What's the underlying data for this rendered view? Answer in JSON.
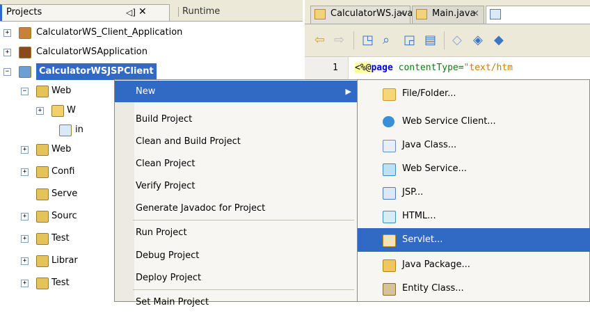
{
  "projects_panel": {
    "tab_projects": "Projects",
    "tab_runtime": "Runtime",
    "pin_glyph": "◁]",
    "close_glyph": "✕",
    "tree": [
      {
        "label": "CalculatorWS_Client_Application",
        "icon": "coffee-cup-icon"
      },
      {
        "label": "CalculatorWSApplication",
        "icon": "coffee-bean-icon"
      },
      {
        "label": "CalculatorWSJSPClient",
        "icon": "globe-icon",
        "selected": true
      },
      {
        "label": "Web",
        "icon": "web-folder-icon"
      },
      {
        "label": "W",
        "icon": "folder-icon"
      },
      {
        "label": "in",
        "icon": "jsp-file-icon"
      },
      {
        "label": "Web",
        "icon": "web-services-icon"
      },
      {
        "label": "Confi",
        "icon": "config-folder-icon"
      },
      {
        "label": "Serve",
        "icon": "server-folder-icon"
      },
      {
        "label": "Sourc",
        "icon": "source-folder-icon"
      },
      {
        "label": "Test",
        "icon": "test-folder-icon"
      },
      {
        "label": "Librar",
        "icon": "libraries-icon"
      },
      {
        "label": "Test",
        "icon": "test-libraries-icon"
      }
    ]
  },
  "editor": {
    "tabs": [
      {
        "label": "CalculatorWS.java"
      },
      {
        "label": "Main.java"
      }
    ],
    "line_number": "1",
    "code_prefix": "<%@",
    "code_keyword": "page",
    "code_attr": " contentType=",
    "code_value": "\"text/htm"
  },
  "context_menu": {
    "items": [
      {
        "label": "New",
        "highlighted": true,
        "submenu": true
      },
      {
        "label": "Build Project"
      },
      {
        "label": "Clean and Build Project"
      },
      {
        "label": "Clean Project"
      },
      {
        "label": "Verify Project"
      },
      {
        "label": "Generate Javadoc for Project"
      },
      {
        "label": "Run Project"
      },
      {
        "label": "Debug Project"
      },
      {
        "label": "Deploy Project"
      },
      {
        "label": "Set Main Project"
      }
    ],
    "submenu_arrow": "▶"
  },
  "new_submenu": {
    "items": [
      {
        "label": "File/Folder...",
        "icon": "file-folder-icon"
      },
      {
        "label": "Web Service Client...",
        "icon": "web-service-client-icon"
      },
      {
        "label": "Java Class...",
        "icon": "java-class-icon"
      },
      {
        "label": "Web Service...",
        "icon": "web-service-icon"
      },
      {
        "label": "JSP...",
        "icon": "jsp-icon"
      },
      {
        "label": "HTML...",
        "icon": "html-icon"
      },
      {
        "label": "Servlet...",
        "icon": "servlet-icon",
        "highlighted": true
      },
      {
        "label": "Java Package...",
        "icon": "java-package-icon"
      },
      {
        "label": "Entity Class...",
        "icon": "entity-class-icon"
      }
    ]
  },
  "colors": {
    "selection": "#316ac5",
    "chrome": "#ece9d8",
    "keyword": "#0000e6",
    "string": "#ce7b00"
  }
}
